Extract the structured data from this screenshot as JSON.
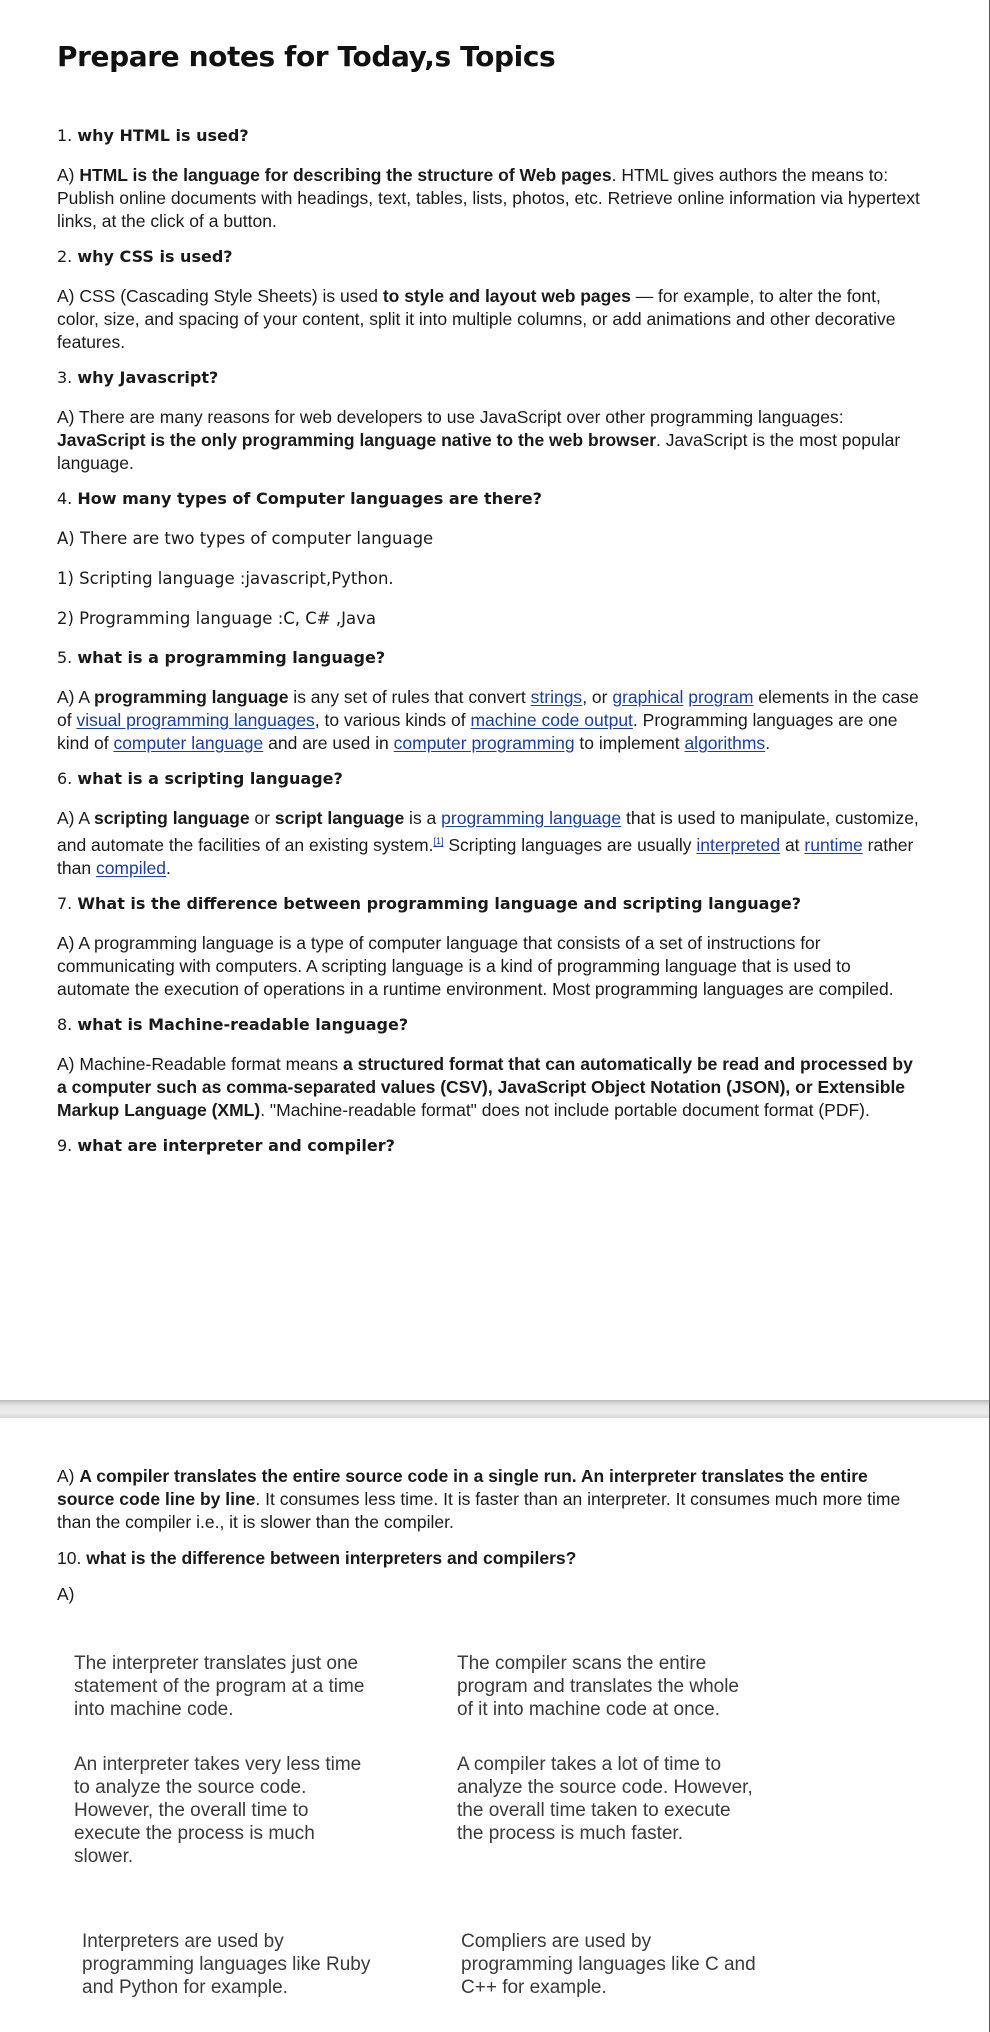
{
  "title": "Prepare notes for Today,s Topics",
  "q1": {
    "num": "1.",
    "text": "why HTML is used?"
  },
  "a1": {
    "prefix": "A) ",
    "bold": "HTML is the language for describing the structure of Web pages",
    "rest": ". HTML gives authors the means to: Publish online documents with headings, text, tables, lists, photos, etc. Retrieve online information via hypertext links, at the click of a button."
  },
  "q2": {
    "num": "2.",
    "text": "why CSS is used?"
  },
  "a2": {
    "prefix": "A) CSS (Cascading Style Sheets) is used ",
    "bold": "to style and layout web pages",
    "rest": " — for example, to alter the font, color, size, and spacing of your content, split it into multiple columns, or add animations and other decorative features."
  },
  "q3": {
    "num": "3.",
    "text": "why Javascript?"
  },
  "a3": {
    "prefix": "A)  There are many reasons for web developers to use JavaScript over other programming languages: ",
    "bold": "JavaScript is the only programming language native to the web browser",
    "rest": ". JavaScript is the most popular language."
  },
  "q4": {
    "num": "4.",
    "text": "How many types of  Computer languages are there?"
  },
  "a4": {
    "line1": "A) There are two types of computer language",
    "line2": "1) Scripting  language :javascript,Python.",
    "line3": "2) Programming language :C, C# ,Java"
  },
  "q5": {
    "num": "5.",
    "text": "what is a programming language?"
  },
  "a5": {
    "t1": "A) A ",
    "b1": "programming language",
    "t2": " is any set of rules that convert ",
    "l1": "strings",
    "t3": ", or ",
    "l2": "graphical",
    "t4": " ",
    "l3": "program",
    "t5": " elements in the case of ",
    "l4": "visual programming languages",
    "t6": ", to various kinds of ",
    "l5": "machine code output",
    "t7": ". Programming languages are one kind of ",
    "l6": "computer language",
    "t8": " and are used in ",
    "l7": "computer programming",
    "t9": " to implement ",
    "l8": "algorithms",
    "t10": "."
  },
  "q6": {
    "num": "6.",
    "text": "what is a scripting language?"
  },
  "a6": {
    "t1": "A) A ",
    "b1": "scripting language",
    "t2": " or ",
    "b2": "script language",
    "t3": " is a ",
    "l1": "programming language",
    "t4": " that is used to manipulate, customize, and automate the facilities of an existing system.",
    "sup": "[1]",
    "t5": " Scripting languages are usually ",
    "l2": "interpreted",
    "t6": " at ",
    "l3": "runtime",
    "t7": " rather than ",
    "l4": "compiled",
    "t8": "."
  },
  "q7": {
    "num": "7.",
    "text": "What is the difference between programming language and scripting language?"
  },
  "a7": "A) A programming language is a type of computer language that consists of a set of instructions for communicating with computers. A scripting language is a kind of programming language that is used to automate the execution of operations in a runtime environment. Most programming languages are compiled.",
  "q8": {
    "num": "8.",
    "text": "what is Machine-readable language?"
  },
  "a8": {
    "prefix": "A) Machine-Readable format means ",
    "bold": "a structured format that can automatically be read and processed by a computer such as comma-separated values (CSV), JavaScript Object Notation (JSON), or Extensible Markup Language (XML)",
    "rest": ". \"Machine-readable format\" does not include portable document format (PDF)."
  },
  "q9": {
    "num": "9.",
    "text": "what are interpreter and compiler?"
  },
  "a9": {
    "prefix": "A) ",
    "bold": "A compiler translates the entire source code in a single run. An interpreter translates the entire source code line by line",
    "rest": ". It consumes less time. It is faster than an interpreter. It consumes much more time than the compiler i.e., it is slower than the compiler."
  },
  "q10": {
    "num": "10.",
    "text": "what is the difference between interpreters and compilers?"
  },
  "a10": "A)",
  "comparison": [
    {
      "interpreter": "The interpreter translates just one statement of the program at a time into machine code.",
      "compiler": "The compiler scans the entire program and translates the whole of it into machine code at once."
    },
    {
      "interpreter": "An interpreter takes very less time to analyze the source code. However, the overall time to execute the process is much slower.",
      "compiler": "A compiler takes a lot of time to analyze the source code. However, the overall time taken to execute the process is much faster."
    },
    {
      "interpreter": "Interpreters are used by programming languages like Ruby and Python for example.",
      "compiler": "Compliers are used by programming languages like C and C++ for example."
    }
  ]
}
